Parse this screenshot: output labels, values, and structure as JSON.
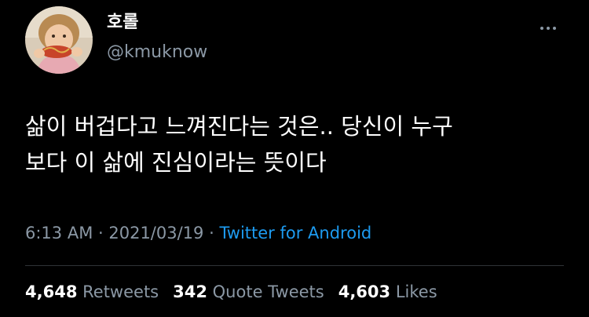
{
  "user": {
    "display_name": "호롤",
    "handle": "@kmuknow"
  },
  "header": {
    "more_icon": "more-horizontal-icon"
  },
  "tweet": {
    "text_lines": [
      "삶이 버겁다고 느껴진다는 것은.. 당신이 누구",
      "보다 이 삶에 진심이라는 뜻이다"
    ]
  },
  "meta": {
    "time": "6:13 AM",
    "sep1": " · ",
    "date": "2021/03/19",
    "sep2": " · ",
    "source": "Twitter for Android"
  },
  "stats": {
    "retweets": {
      "count": "4,648",
      "label": "Retweets"
    },
    "quote_tweets": {
      "count": "342",
      "label": "Quote Tweets"
    },
    "likes": {
      "count": "4,603",
      "label": "Likes"
    }
  },
  "colors": {
    "background": "#000000",
    "primary_text": "#ffffff",
    "secondary_text": "#8b98a5",
    "link": "#1d9bf0",
    "divider": "#2f3336"
  }
}
